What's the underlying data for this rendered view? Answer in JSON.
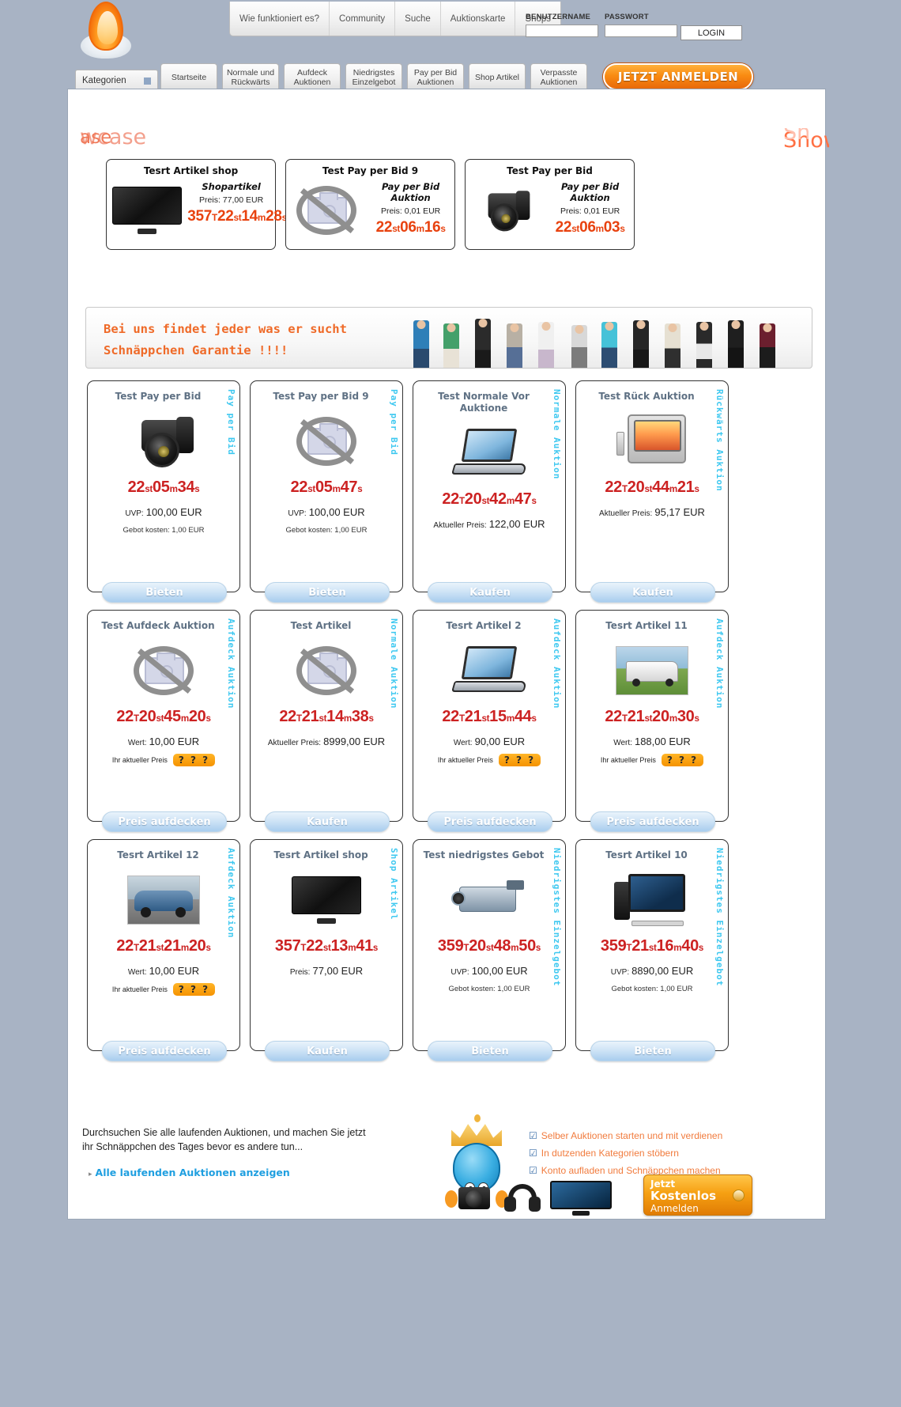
{
  "header": {
    "logo_name": "flame-logo",
    "nav": [
      "Wie funktioniert es?",
      "Community",
      "Suche",
      "Auktionskarte",
      "Shops"
    ],
    "username_label": "BENUTZERNAME",
    "password_label": "PASSWORT",
    "username_value": "",
    "password_value": "",
    "login_label": "LOGIN",
    "register_label": "JETZT ANMELDEN",
    "categories_label": "Kategorien",
    "tabs": [
      "Startseite",
      "Normale und Rückwärts",
      "Aufdeck Auktionen",
      "Niedrigstes Einzelgebot",
      "Pay per Bid Auktionen",
      "Shop Artikel",
      "Verpasste Auktionen"
    ]
  },
  "showcase": {
    "title_left_back": "wcase",
    "title_left_front": "ase",
    "title_right_back": "Sh",
    "title_right_front": "Showc",
    "items": [
      {
        "title": "Tesrt Artikel shop",
        "type": "Shopartikel",
        "price": "Preis: 77,00 EUR",
        "image": "tv-image",
        "timer": [
          {
            "v": "357",
            "u": "T"
          },
          {
            "v": "22",
            "u": "st"
          },
          {
            "v": "14",
            "u": "m"
          },
          {
            "v": "28",
            "u": "s"
          }
        ]
      },
      {
        "title": "Test Pay per Bid 9",
        "type": "Pay per Bid Auktion",
        "price": "Preis: 0,01 EUR",
        "image": "no-image",
        "timer": [
          {
            "v": "22",
            "u": "st"
          },
          {
            "v": "06",
            "u": "m"
          },
          {
            "v": "16",
            "u": "s"
          }
        ]
      },
      {
        "title": "Test Pay per Bid",
        "type": "Pay per Bid Auktion",
        "price": "Preis: 0,01 EUR",
        "image": "dslr-image",
        "timer": [
          {
            "v": "22",
            "u": "st"
          },
          {
            "v": "06",
            "u": "m"
          },
          {
            "v": "03",
            "u": "s"
          }
        ]
      }
    ]
  },
  "banner": {
    "line1": "Bei uns findet jeder was er sucht",
    "line2": "Schnäppchen Garantie !!!!"
  },
  "products": [
    {
      "title": "Test Pay per Bid",
      "vtype": "Pay per Bid",
      "image": "dslr-image",
      "timer": [
        {
          "v": "22",
          "u": "st"
        },
        {
          "v": "05",
          "u": "m"
        },
        {
          "v": "34",
          "u": "s"
        }
      ],
      "price_label": "UVP:",
      "price_value": "100,00 EUR",
      "sub": "Gebot kosten: 1,00 EUR",
      "reveal_label": "",
      "reveal_badge": "",
      "button": "Bieten"
    },
    {
      "title": "Test Pay per Bid 9",
      "vtype": "Pay per Bid",
      "image": "no-image",
      "timer": [
        {
          "v": "22",
          "u": "st"
        },
        {
          "v": "05",
          "u": "m"
        },
        {
          "v": "47",
          "u": "s"
        }
      ],
      "price_label": "UVP:",
      "price_value": "100,00 EUR",
      "sub": "Gebot kosten: 1,00 EUR",
      "reveal_label": "",
      "reveal_badge": "",
      "button": "Bieten"
    },
    {
      "title": "Test Normale Vor Auktione",
      "vtype": "Normale Auktion",
      "image": "laptop-image",
      "timer": [
        {
          "v": "22",
          "u": "T"
        },
        {
          "v": "20",
          "u": "st"
        },
        {
          "v": "42",
          "u": "m"
        },
        {
          "v": "47",
          "u": "s"
        }
      ],
      "price_label": "Aktueller Preis:",
      "price_value": "122,00 EUR",
      "sub": "",
      "reveal_label": "",
      "reveal_badge": "",
      "button": "Kaufen"
    },
    {
      "title": "Test Rück Auktion",
      "vtype": "Rückwärts Auktion",
      "image": "crt-tv-image",
      "timer": [
        {
          "v": "22",
          "u": "T"
        },
        {
          "v": "20",
          "u": "st"
        },
        {
          "v": "44",
          "u": "m"
        },
        {
          "v": "21",
          "u": "s"
        }
      ],
      "price_label": "Aktueller Preis:",
      "price_value": "95,17 EUR",
      "sub": "",
      "reveal_label": "",
      "reveal_badge": "",
      "button": "Kaufen"
    },
    {
      "title": "Test Aufdeck Auktion",
      "vtype": "Aufdeck Auktion",
      "image": "no-image",
      "timer": [
        {
          "v": "22",
          "u": "T"
        },
        {
          "v": "20",
          "u": "st"
        },
        {
          "v": "45",
          "u": "m"
        },
        {
          "v": "20",
          "u": "s"
        }
      ],
      "price_label": "Wert:",
      "price_value": "10,00 EUR",
      "sub": "",
      "reveal_label": "Ihr aktueller Preis",
      "reveal_badge": "? ? ?",
      "button": "Preis aufdecken"
    },
    {
      "title": "Test Artikel",
      "vtype": "Normale Auktion",
      "image": "no-image",
      "timer": [
        {
          "v": "22",
          "u": "T"
        },
        {
          "v": "21",
          "u": "st"
        },
        {
          "v": "14",
          "u": "m"
        },
        {
          "v": "38",
          "u": "s"
        }
      ],
      "price_label": "Aktueller Preis:",
      "price_value": "8999,00 EUR",
      "sub": "",
      "reveal_label": "",
      "reveal_badge": "",
      "button": "Kaufen"
    },
    {
      "title": "Tesrt Artikel 2",
      "vtype": "Aufdeck Auktion",
      "image": "laptop-image",
      "timer": [
        {
          "v": "22",
          "u": "T"
        },
        {
          "v": "21",
          "u": "st"
        },
        {
          "v": "15",
          "u": "m"
        },
        {
          "v": "44",
          "u": "s"
        }
      ],
      "price_label": "Wert:",
      "price_value": "90,00 EUR",
      "sub": "",
      "reveal_label": "Ihr aktueller Preis",
      "reveal_badge": "? ? ?",
      "button": "Preis aufdecken"
    },
    {
      "title": "Tesrt Artikel 11",
      "vtype": "Aufdeck Auktion",
      "image": "rv-image",
      "timer": [
        {
          "v": "22",
          "u": "T"
        },
        {
          "v": "21",
          "u": "st"
        },
        {
          "v": "20",
          "u": "m"
        },
        {
          "v": "30",
          "u": "s"
        }
      ],
      "price_label": "Wert:",
      "price_value": "188,00 EUR",
      "sub": "",
      "reveal_label": "Ihr aktueller Preis",
      "reveal_badge": "? ? ?",
      "button": "Preis aufdecken"
    },
    {
      "title": "Tesrt Artikel 12",
      "vtype": "Aufdeck Auktion",
      "image": "car-image",
      "timer": [
        {
          "v": "22",
          "u": "T"
        },
        {
          "v": "21",
          "u": "st"
        },
        {
          "v": "21",
          "u": "m"
        },
        {
          "v": "20",
          "u": "s"
        }
      ],
      "price_label": "Wert:",
      "price_value": "10,00 EUR",
      "sub": "",
      "reveal_label": "Ihr aktueller Preis",
      "reveal_badge": "? ? ?",
      "button": "Preis aufdecken"
    },
    {
      "title": "Tesrt Artikel shop",
      "vtype": "Shop Artikel",
      "image": "tv-image",
      "timer": [
        {
          "v": "357",
          "u": "T"
        },
        {
          "v": "22",
          "u": "st"
        },
        {
          "v": "13",
          "u": "m"
        },
        {
          "v": "41",
          "u": "s"
        }
      ],
      "price_label": "Preis:",
      "price_value": "77,00 EUR",
      "sub": "",
      "reveal_label": "",
      "reveal_badge": "",
      "button": "Kaufen"
    },
    {
      "title": "Test niedrigstes Gebot",
      "vtype": "Niedrigstes Einzelgebot",
      "image": "camcorder-image",
      "timer": [
        {
          "v": "359",
          "u": "T"
        },
        {
          "v": "20",
          "u": "st"
        },
        {
          "v": "48",
          "u": "m"
        },
        {
          "v": "50",
          "u": "s"
        }
      ],
      "price_label": "UVP:",
      "price_value": "100,00 EUR",
      "sub": "Gebot kosten: 1,00 EUR",
      "reveal_label": "",
      "reveal_badge": "",
      "button": "Bieten"
    },
    {
      "title": "Tesrt Artikel 10",
      "vtype": "Niedrigstes Einzelgebot",
      "image": "desktop-pc-image",
      "timer": [
        {
          "v": "359",
          "u": "T"
        },
        {
          "v": "21",
          "u": "st"
        },
        {
          "v": "16",
          "u": "m"
        },
        {
          "v": "40",
          "u": "s"
        }
      ],
      "price_label": "UVP:",
      "price_value": "8890,00 EUR",
      "sub": "Gebot kosten: 1,00 EUR",
      "reveal_label": "",
      "reveal_badge": "",
      "button": "Bieten"
    }
  ],
  "footer": {
    "text": "Durchsuchen Sie alle laufenden Auktionen, und machen Sie jetzt ihr Schnäppchen des Tages bevor es andere tun...",
    "link": "Alle laufenden Auktionen anzeigen",
    "benefits": [
      "Selber Auktionen starten und mit verdienen",
      "In dutzenden Kategorien stöbern",
      "Konto aufladen und Schnäppchen machen"
    ],
    "register": {
      "line1": "Jetzt",
      "line2": "Kostenlos",
      "line3": "Anmelden"
    }
  },
  "colors": {
    "accent_orange": "#ef6a0b",
    "timer_red": "#cc2222",
    "vtype_cyan": "#3ec8f0",
    "title_slate": "#5f7184",
    "link_blue": "#1f9fe0",
    "page_bg": "#a8b3c4"
  }
}
